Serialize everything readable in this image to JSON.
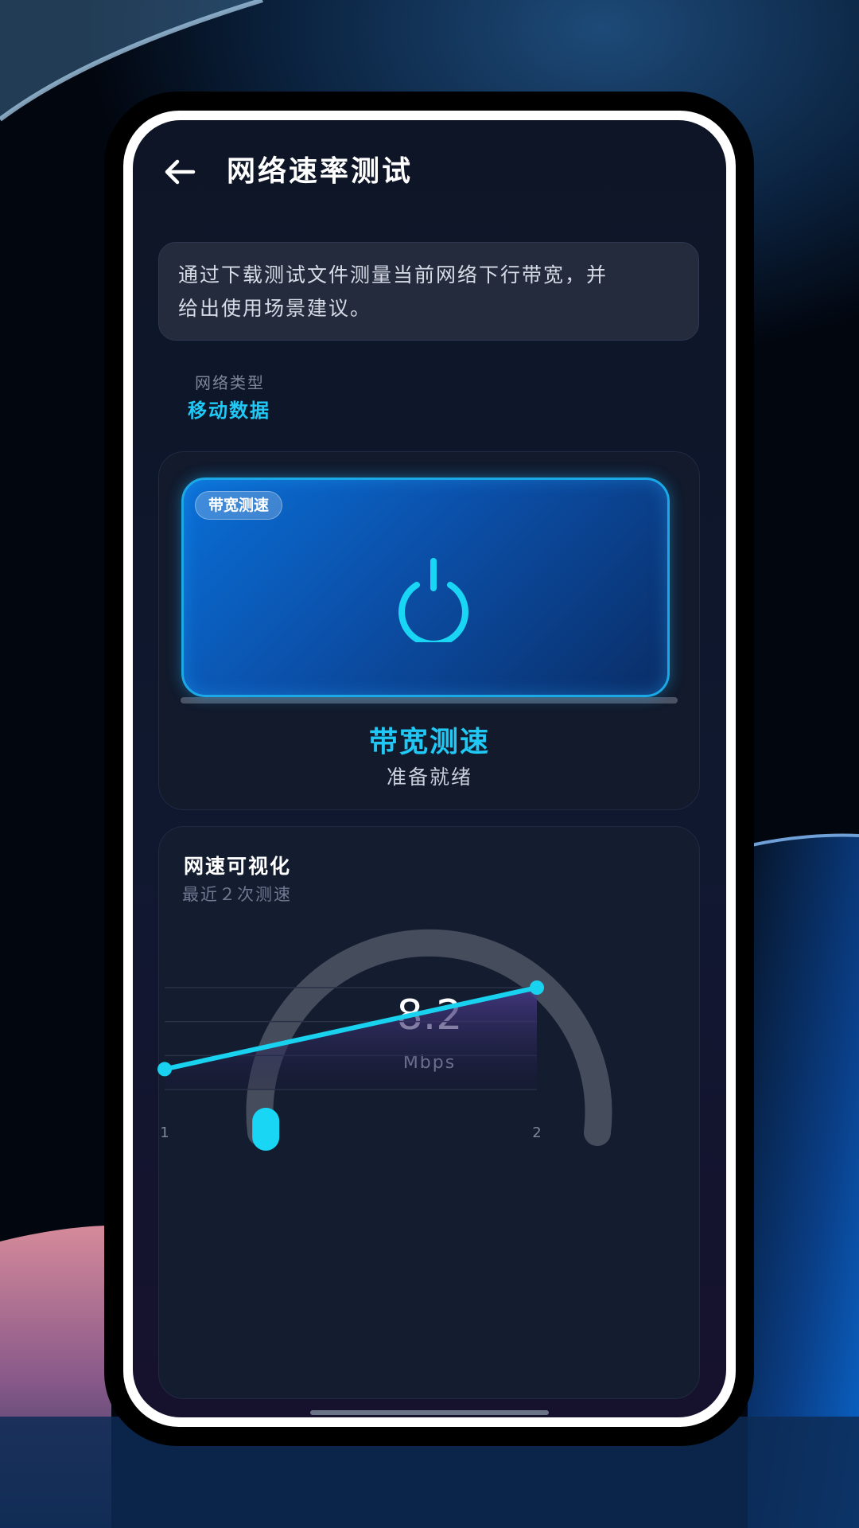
{
  "header": {
    "title": "网络速率测试"
  },
  "description": {
    "line1": "通过下载测试文件测量当前网络下行带宽，并",
    "line2": "给出使用场景建议。"
  },
  "network": {
    "type_label": "网络类型",
    "type_value": "移动数据"
  },
  "speedtest": {
    "chip_label": "带宽测速",
    "title": "带宽测速",
    "status": "准备就绪"
  },
  "visualization": {
    "title": "网速可视化",
    "subtitle": "最近２次测速",
    "gauge_value": "8.2",
    "gauge_unit": "Mbps",
    "gauge_fraction": 0.03
  },
  "colors": {
    "accent": "#1fc8f5",
    "line": "#18d2ef"
  },
  "chart_data": {
    "type": "line",
    "x": [
      1,
      2
    ],
    "tick_labels": [
      "1",
      "2"
    ],
    "series": [
      {
        "values": [
          0.2,
          1.0
        ]
      }
    ],
    "ylim": [
      0,
      1.0
    ],
    "grid": true,
    "xlabel": "",
    "ylabel": ""
  }
}
